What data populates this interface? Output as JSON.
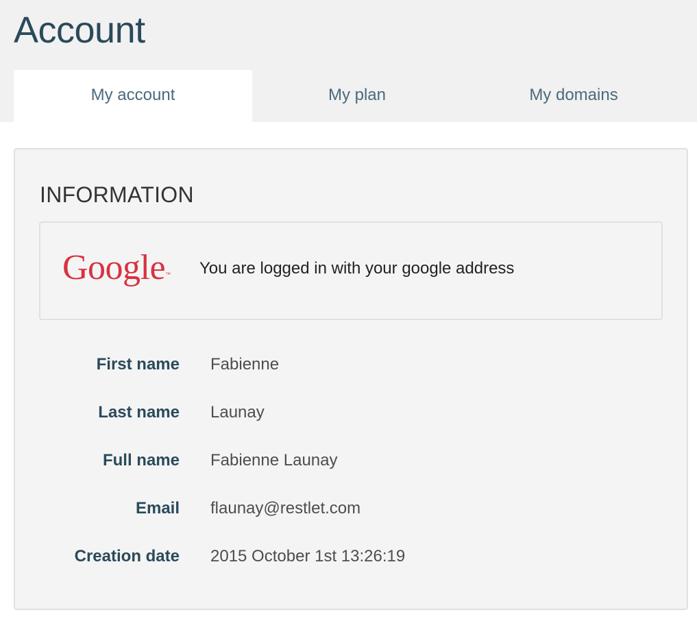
{
  "page": {
    "title": "Account"
  },
  "tabs": [
    {
      "label": "My account",
      "active": true
    },
    {
      "label": "My plan",
      "active": false
    },
    {
      "label": "My domains",
      "active": false
    }
  ],
  "information": {
    "title": "INFORMATION",
    "google": {
      "logo_text": "Google",
      "trademark": "™",
      "message": "You are logged in with your google address"
    },
    "fields": [
      {
        "label": "First name",
        "value": "Fabienne"
      },
      {
        "label": "Last name",
        "value": "Launay"
      },
      {
        "label": "Full name",
        "value": "Fabienne Launay"
      },
      {
        "label": "Email",
        "value": "flaunay@restlet.com"
      },
      {
        "label": "Creation date",
        "value": "2015 October 1st 13:26:19"
      }
    ]
  },
  "colors": {
    "header_bg": "#f1f1f1",
    "title": "#2a4a5a",
    "tab_text": "#4a6a7c",
    "panel_bg": "#f4f4f4",
    "google_red": "#d8323f"
  }
}
